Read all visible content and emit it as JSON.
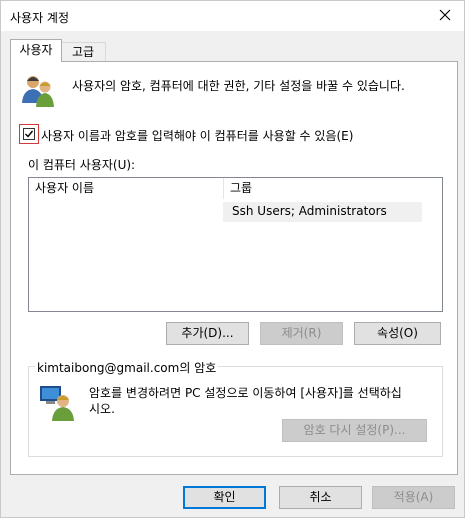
{
  "window": {
    "title": "사용자 계정"
  },
  "tabs": [
    {
      "label": "사용자",
      "selected": true
    },
    {
      "label": "고급",
      "selected": false
    }
  ],
  "users_tab": {
    "intro_text": "사용자의 암호, 컴퓨터에 대한 권한, 기타 설정을 바꿀 수 있습니다.",
    "require_login_checkbox": {
      "label": "사용자 이름과 암호를 입력해야 이 컴퓨터를 사용할 수 있음(E)",
      "checked": true
    },
    "users_list_label": "이 컴퓨터 사용자(U):",
    "table": {
      "columns": [
        "사용자 이름",
        "그룹"
      ],
      "rows": [
        {
          "user_name": "",
          "group": "Ssh Users; Administrators"
        }
      ]
    },
    "buttons": {
      "add": "추가(D)...",
      "remove": "제거(R)",
      "properties": "속성(O)"
    },
    "password_group": {
      "title": "kimtaibong@gmail.com의 암호",
      "description_line1": "암호를 변경하려면 PC 설정으로 이동하여 [사용자]를 선택하십",
      "description_line2": "시오.",
      "reset_button": "암호 다시 설정(P)..."
    }
  },
  "dialog_buttons": {
    "ok": "확인",
    "cancel": "취소",
    "apply": "적용(A)"
  },
  "colors": {
    "accent": "#0078d7",
    "checkbox_highlight": "#d03a3a",
    "disabled_text": "#8d8d8d"
  }
}
